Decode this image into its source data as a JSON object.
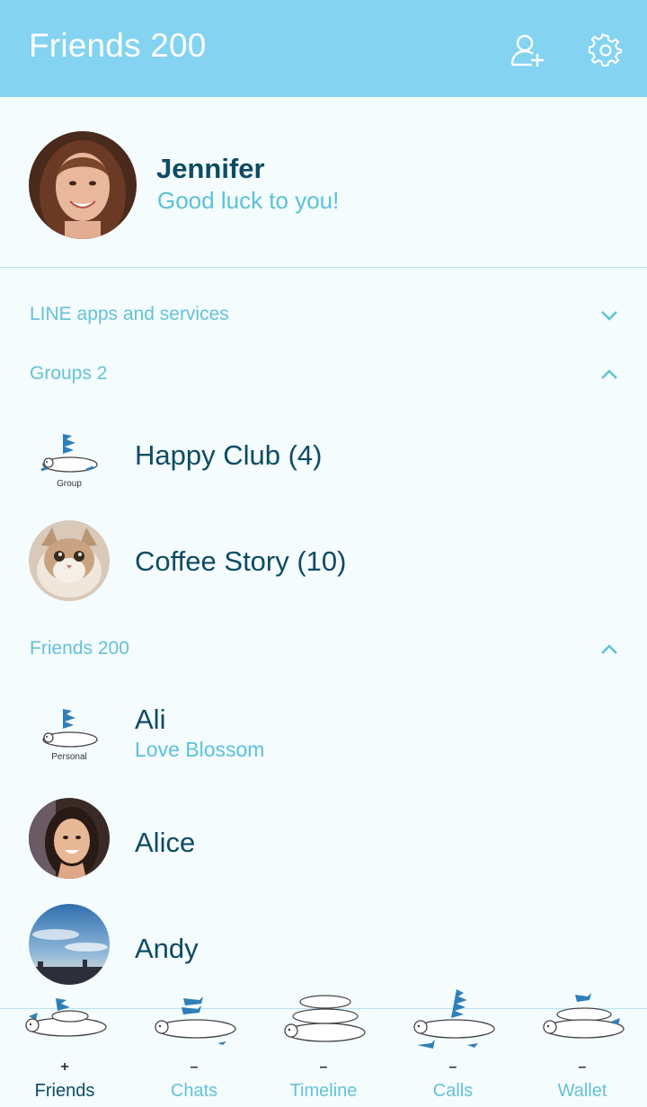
{
  "header": {
    "title": "Friends 200",
    "add_friend_icon": "add-person-icon",
    "settings_icon": "gear-icon",
    "background": "#83d3f1"
  },
  "profile": {
    "name": "Jennifer",
    "status": "Good luck to you!"
  },
  "sections": {
    "apps": {
      "label": "LINE apps and services",
      "state": "collapsed"
    },
    "groups": {
      "label": "Groups 2",
      "state": "expanded"
    },
    "friends": {
      "label": "Friends 200",
      "state": "expanded"
    }
  },
  "groups": [
    {
      "name": "Happy Club (4)",
      "avatar_caption": "Group"
    },
    {
      "name": "Coffee Story (10)"
    }
  ],
  "friends": [
    {
      "name": "Ali",
      "status": "Love Blossom",
      "avatar_caption": "Personal"
    },
    {
      "name": "Alice",
      "status": ""
    },
    {
      "name": "Andy",
      "status": ""
    }
  ],
  "bottom_nav": {
    "tabs": [
      {
        "label": "Friends",
        "mark": "+",
        "active": true
      },
      {
        "label": "Chats",
        "mark": "–",
        "active": false
      },
      {
        "label": "Timeline",
        "mark": "–",
        "active": false
      },
      {
        "label": "Calls",
        "mark": "–",
        "active": false
      },
      {
        "label": "Wallet",
        "mark": "–",
        "active": false
      }
    ]
  },
  "colors": {
    "accent": "#65c2d6",
    "primary_text": "#0d4b63",
    "background": "#f4fcfe"
  }
}
